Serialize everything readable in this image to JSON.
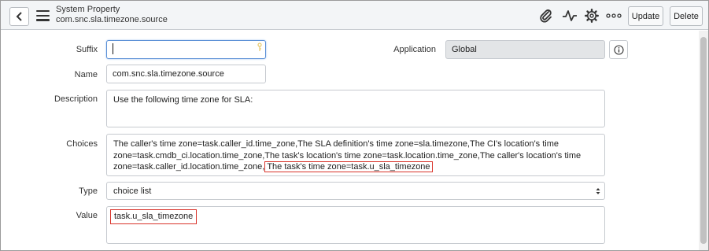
{
  "header": {
    "record_type": "System Property",
    "record_name": "com.snc.sla.timezone.source",
    "update_label": "Update",
    "delete_label": "Delete"
  },
  "form": {
    "suffix": {
      "label": "Suffix",
      "value": ""
    },
    "application": {
      "label": "Application",
      "value": "Global"
    },
    "name": {
      "label": "Name",
      "value": "com.snc.sla.timezone.source"
    },
    "description": {
      "label": "Description",
      "value": "Use the following time zone for SLA:"
    },
    "choices": {
      "label": "Choices",
      "line1": "The caller's time zone=task.caller_id.time_zone,The SLA definition's time zone=sla.timezone,The CI's location's time",
      "line2": "zone=task.cmdb_ci.location.time_zone,The task's location's time zone=task.location.time_zone,The caller's location's time",
      "line3_prefix": "zone=task.caller_id.location.time_zone,",
      "line3_highlight": "The task's time zone=task.u_sla_timezone"
    },
    "type": {
      "label": "Type",
      "value": "choice list"
    },
    "value": {
      "label": "Value",
      "value": "task.u_sla_timezone"
    }
  },
  "colors": {
    "highlight": "#d9342b",
    "focus": "#5a8fd6",
    "readonly_bg": "#e3e5e7"
  }
}
